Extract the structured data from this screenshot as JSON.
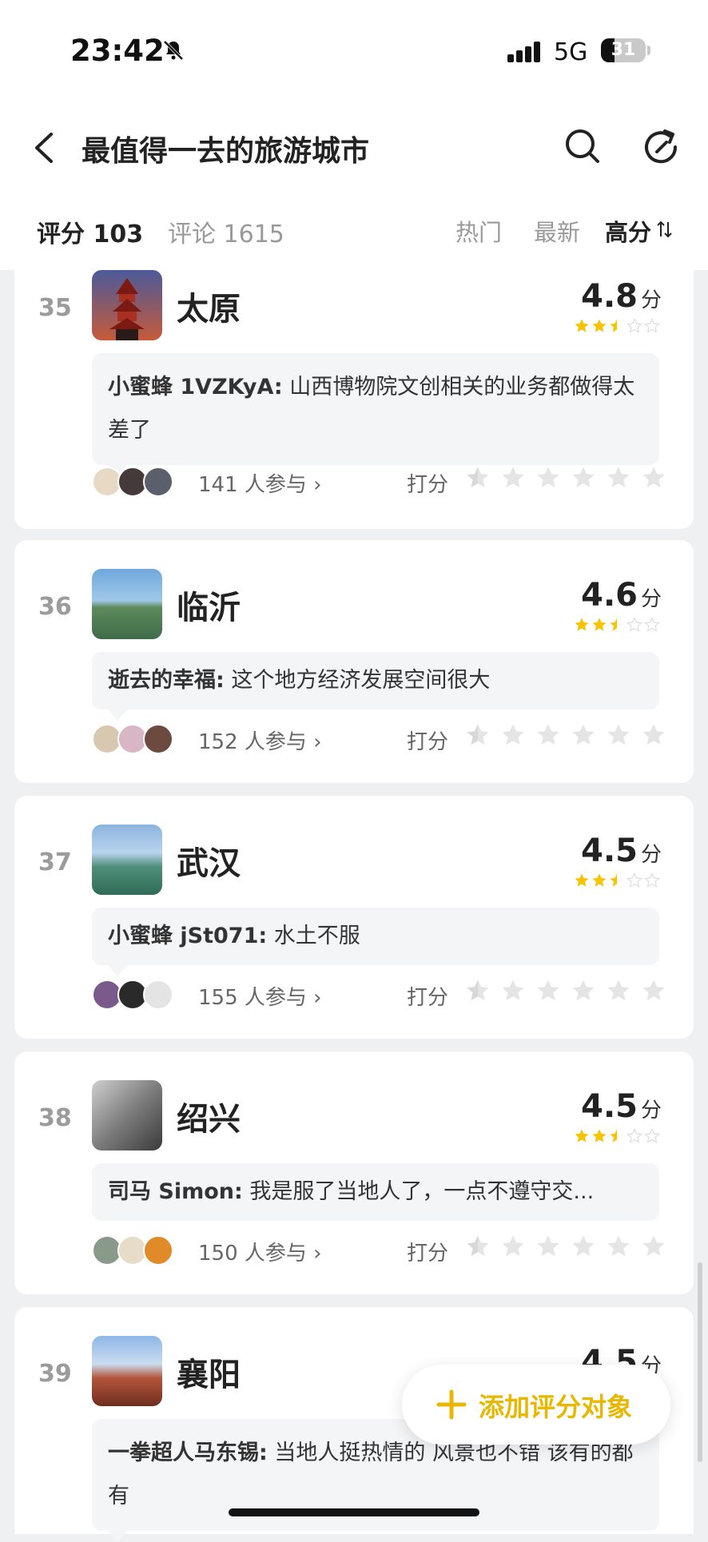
{
  "status_bar": {
    "time": "23:42",
    "network": "5G",
    "battery": "31"
  },
  "nav": {
    "title": "最值得一去的旅游城市"
  },
  "tabs": [
    {
      "label": "评分 103",
      "active": true
    },
    {
      "label": "评论 1615",
      "active": false
    }
  ],
  "sort_options": [
    {
      "label": "热门",
      "active": false
    },
    {
      "label": "最新",
      "active": false
    },
    {
      "label": "高分",
      "active": true
    }
  ],
  "items": [
    {
      "rank": "35",
      "name": "太原",
      "score": "4.8",
      "unit": "分",
      "stars": 2.5,
      "comment_author": "小蜜蜂 1VZKyA:",
      "comment_text": "山西博物院文创相关的业务都做得太差了",
      "participants": "141 人参与 ›",
      "rate_label": "打分",
      "thumb_color": "#3b3f66"
    },
    {
      "rank": "36",
      "name": "临沂",
      "score": "4.6",
      "unit": "分",
      "stars": 2.5,
      "comment_author": "逝去的幸福:",
      "comment_text": "这个地方经济发展空间很大",
      "participants": "152 人参与 ›",
      "rate_label": "打分",
      "thumb_color": "#6d9ac9"
    },
    {
      "rank": "37",
      "name": "武汉",
      "score": "4.5",
      "unit": "分",
      "stars": 2.5,
      "comment_author": "小蜜蜂 jSt071:",
      "comment_text": "水土不服",
      "participants": "155 人参与 ›",
      "rate_label": "打分",
      "thumb_color": "#4f8f7a"
    },
    {
      "rank": "38",
      "name": "绍兴",
      "score": "4.5",
      "unit": "分",
      "stars": 2.5,
      "comment_author": "司马 Simon:",
      "comment_text": "我是服了当地人了，一点不遵守交...",
      "participants": "150 人参与 ›",
      "rate_label": "打分",
      "thumb_color": "#8a8a8a"
    },
    {
      "rank": "39",
      "name": "襄阳",
      "score": "4.5",
      "unit": "分",
      "stars": 2.5,
      "comment_author": "一拳超人马东锡:",
      "comment_text": "当地人挺热情的 风景也不错 该有的都有",
      "participants": "",
      "rate_label": "",
      "thumb_color": "#b4553a"
    }
  ],
  "fab": {
    "label": "添加评分对象"
  },
  "colors": {
    "star": "#f6c400",
    "star_empty": "#e5e5e5",
    "accent": "#e8b700"
  }
}
